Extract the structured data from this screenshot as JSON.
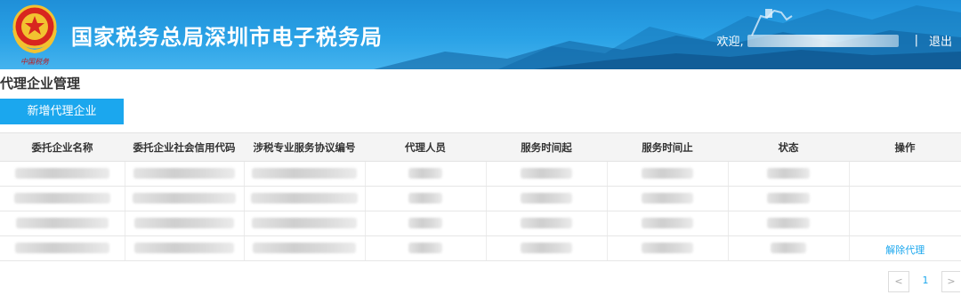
{
  "header": {
    "site_title": "国家税务总局深圳市电子税务局",
    "emblem_caption": "中国税务",
    "welcome": "欢迎,",
    "separator": "|",
    "logout": "退出"
  },
  "page": {
    "title": "代理企业管理",
    "add_button": "新增代理企业"
  },
  "table": {
    "columns": [
      "委托企业名称",
      "委托企业社会信用代码",
      "涉税专业服务协议编号",
      "代理人员",
      "服务时间起",
      "服务时间止",
      "状态",
      "操作"
    ],
    "rows": [
      {
        "action": ""
      },
      {
        "action": ""
      },
      {
        "action": ""
      },
      {
        "action": "解除代理"
      }
    ]
  },
  "pagination": {
    "prev": "<",
    "current_page": "1",
    "next": ">"
  },
  "colors": {
    "header_bg": "#2aa2e6",
    "primary": "#1ba7ee",
    "table_header_bg": "#f4f4f4"
  },
  "icons": {
    "emblem": "national-tax-emblem-icon",
    "prev": "chevron-left-icon",
    "next": "chevron-right-icon"
  }
}
